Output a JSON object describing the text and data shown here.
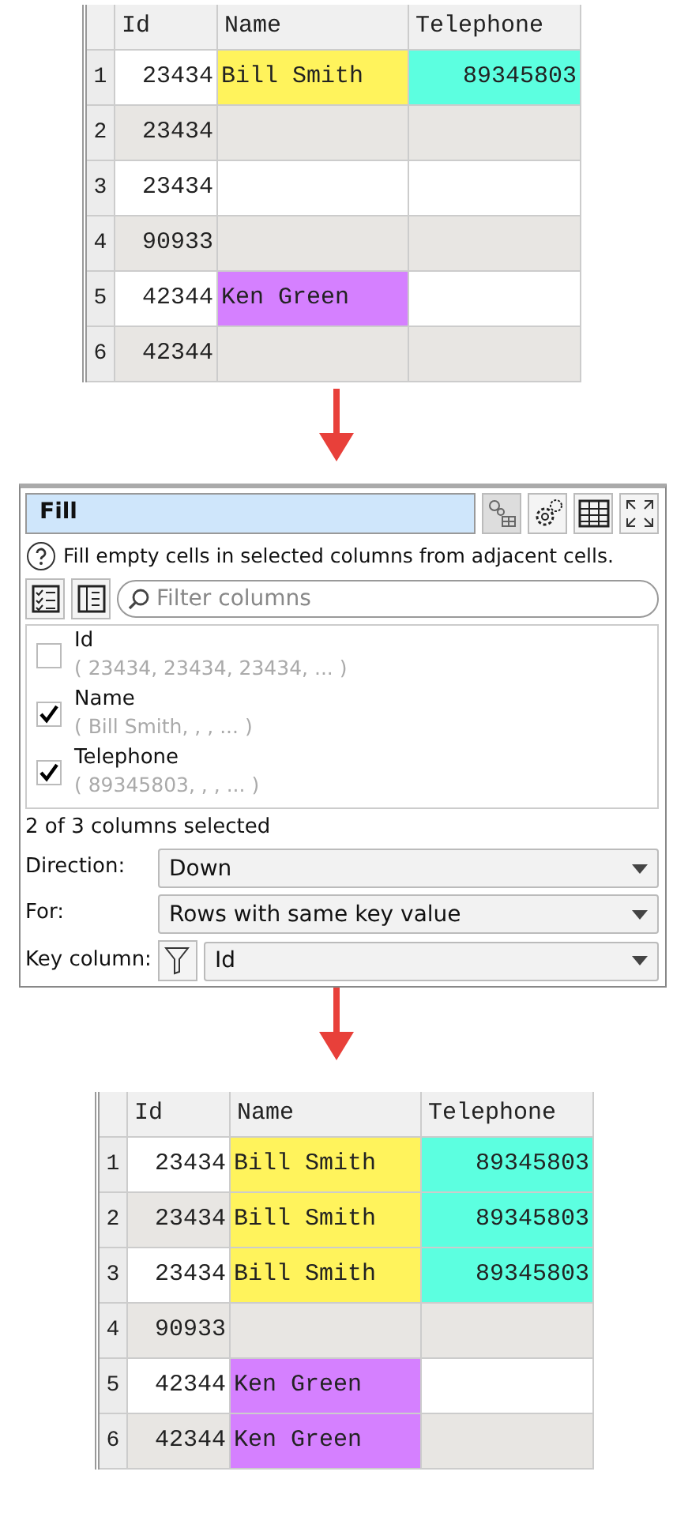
{
  "table_before": {
    "columns": [
      "Id",
      "Name",
      "Telephone"
    ],
    "rows": [
      {
        "number": "1",
        "cells": [
          {
            "text": "23434"
          },
          {
            "text": "Bill Smith",
            "color": "#fff35c"
          },
          {
            "text": "89345803",
            "color": "#5cffe0"
          }
        ]
      },
      {
        "number": "2",
        "cells": [
          {
            "text": "23434"
          },
          {},
          {}
        ]
      },
      {
        "number": "3",
        "cells": [
          {
            "text": "23434"
          },
          {},
          {}
        ]
      },
      {
        "number": "4",
        "cells": [
          {
            "text": "90933"
          },
          {},
          {}
        ]
      },
      {
        "number": "5",
        "cells": [
          {
            "text": "42344"
          },
          {
            "text": "Ken Green",
            "color": "#d580ff"
          },
          {}
        ]
      },
      {
        "number": "6",
        "cells": [
          {
            "text": "42344"
          },
          {},
          {}
        ]
      }
    ]
  },
  "fill_panel": {
    "title": "Fill",
    "help": "Fill empty cells in selected columns from adjacent cells.",
    "filter": {
      "placeholder": "Filter columns"
    },
    "columns": [
      {
        "name": "Id",
        "preview": "( 23434, 23434, 23434, ... )",
        "checked": false
      },
      {
        "name": "Name",
        "preview": "( Bill Smith, , , ... )",
        "checked": true
      },
      {
        "name": "Telephone",
        "preview": "( 89345803, , , ... )",
        "checked": true
      }
    ],
    "selection_count": "2 of 3 columns selected",
    "options": [
      {
        "label": "Direction:",
        "value": "Down",
        "kind": "select"
      },
      {
        "label": "For:",
        "value": "Rows with same key value",
        "kind": "select"
      },
      {
        "label": "Key column:",
        "value": "Id",
        "kind": "filtered-select"
      }
    ]
  },
  "table_after": {
    "columns": [
      "Id",
      "Name",
      "Telephone"
    ],
    "rows": [
      {
        "number": "1",
        "cells": [
          {
            "text": "23434"
          },
          {
            "text": "Bill Smith",
            "color": "#fff35c"
          },
          {
            "text": "89345803",
            "color": "#5cffe0"
          }
        ]
      },
      {
        "number": "2",
        "cells": [
          {
            "text": "23434"
          },
          {
            "text": "Bill Smith",
            "color": "#fff35c"
          },
          {
            "text": "89345803",
            "color": "#5cffe0"
          }
        ]
      },
      {
        "number": "3",
        "cells": [
          {
            "text": "23434"
          },
          {
            "text": "Bill Smith",
            "color": "#fff35c"
          },
          {
            "text": "89345803",
            "color": "#5cffe0"
          }
        ]
      },
      {
        "number": "4",
        "cells": [
          {
            "text": "90933"
          },
          {},
          {}
        ]
      },
      {
        "number": "5",
        "cells": [
          {
            "text": "42344"
          },
          {
            "text": "Ken Green",
            "color": "#d580ff"
          },
          {}
        ]
      },
      {
        "number": "6",
        "cells": [
          {
            "text": "42344"
          },
          {
            "text": "Ken Green",
            "color": "#d580ff"
          },
          {}
        ]
      }
    ]
  }
}
